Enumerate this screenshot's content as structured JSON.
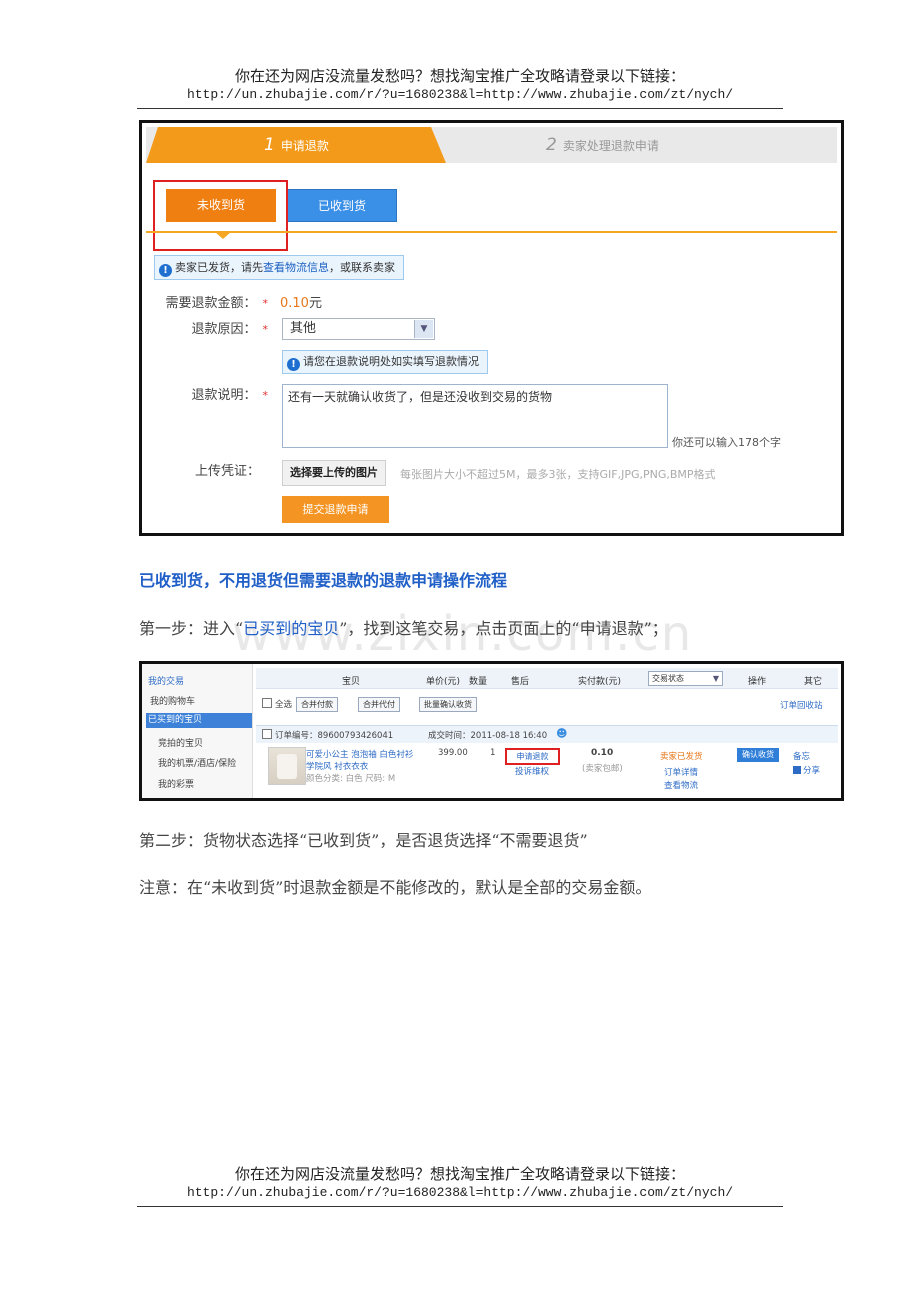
{
  "header": {
    "line1": "你在还为网店没流量发愁吗？想找淘宝推广全攻略请登录以下链接：",
    "line2": "http://un.zhubajie.com/r/?u=1680238&l=http://www.zhubajie.com/zt/nych/"
  },
  "footer": {
    "line1": "你在还为网店没流量发愁吗？想找淘宝推广全攻略请登录以下链接：",
    "line2": "http://un.zhubajie.com/r/?u=1680238&l=http://www.zhubajie.com/zt/nych/"
  },
  "refund_form": {
    "tab1_num": "1",
    "tab1_label": "申请退款",
    "tab2_num": "2",
    "tab2_label": "卖家处理退款申请",
    "btn_not_received": "未收到货",
    "btn_received": "已收到货",
    "notice_pre": "卖家已发货，请先",
    "notice_link": "查看物流信息",
    "notice_post": "，或联系卖家",
    "amount_label": "需要退款金额：",
    "amount_value": "0.10",
    "amount_unit": "元",
    "reason_label": "退款原因：",
    "reason_value": "其他",
    "reason_tip": "请您在退款说明处如实填写退款情况",
    "desc_label": "退款说明：",
    "desc_value": "还有一天就确认收货了，但是还没收到交易的货物",
    "remaining": "你还可以输入178个字",
    "upload_label": "上传凭证：",
    "upload_button": "选择要上传的图片",
    "upload_hint": "每张图片大小不超过5M，最多3张，支持GIF,JPG,PNG,BMP格式",
    "submit_button": "提交退款申请",
    "star": "*"
  },
  "heading": "已收到货，不用退货但需要退款的退款申请操作流程",
  "step1_pre": "第一步：进入“",
  "step1_link": "已买到的宝贝",
  "step1_post": "”，找到这笔交易，点击页面上的“申请退款”；",
  "watermark": "www.zixin.com.cn",
  "orders": {
    "sidebar_title": "我的交易",
    "sidebar_items": [
      "我的购物车",
      "已买到的宝贝",
      "竞拍的宝贝",
      "我的机票/酒店/保险",
      "我的彩票"
    ],
    "col_item": "宝贝",
    "col_price": "单价(元)",
    "col_qty": "数量",
    "col_after": "售后",
    "col_paid": "实付款(元)",
    "col_status": "交易状态",
    "col_action": "操作",
    "col_other": "其它",
    "select_all": "全选",
    "btn_merge_pay": "合并付款",
    "btn_merge_agent": "合并代付",
    "btn_batch_confirm": "批量确认收货",
    "recycle": "订单回收站",
    "order_no": "订单编号：89600793426041",
    "deal_time": "成交时间：2011-08-18 16:40",
    "item_title1": "可爱小公主 泡泡袖 白色衬衫",
    "item_title2": "学院风 衬衣衣衣",
    "item_spec": "颜色分类: 白色 尺码: M",
    "price": "399.00",
    "qty": "1",
    "refund_btn": "申请退款",
    "complain": "投诉维权",
    "paid": "0.10",
    "shipping": "(卖家包邮)",
    "status": "卖家已发货",
    "order_detail": "订单详情",
    "logistics": "查看物流",
    "confirm_btn": "确认收货",
    "memo": "备忘",
    "share": "分享"
  },
  "step2": "第二步：货物状态选择“已收到货”，是否退货选择“不需要退货”",
  "note": "注意：在“未收到货”时退款金额是不能修改的，默认是全部的交易金额。"
}
